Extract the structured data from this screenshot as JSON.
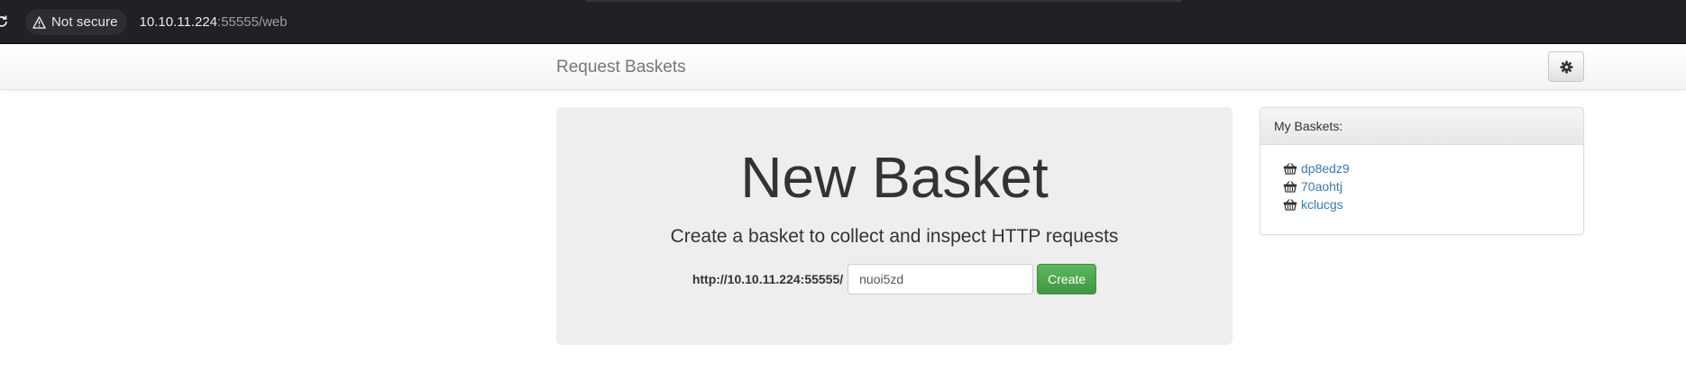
{
  "browser": {
    "security_label": "Not secure",
    "url_host": "10.10.11.224",
    "url_rest": ":55555/web"
  },
  "navbar": {
    "brand": "Request Baskets",
    "settings_icon": "gear-icon"
  },
  "jumbotron": {
    "title": "New Basket",
    "lead": "Create a basket to collect and inspect HTTP requests",
    "url_prefix": "http://10.10.11.224:55555/",
    "basket_name_value": "nuoi5zd",
    "create_label": "Create"
  },
  "my_baskets": {
    "heading": "My Baskets:",
    "items": [
      {
        "name": "dp8edz9",
        "icon": "basket-icon"
      },
      {
        "name": "70aohtj",
        "icon": "basket-icon"
      },
      {
        "name": "kclucgs",
        "icon": "basket-icon"
      }
    ]
  },
  "colors": {
    "chrome_bg": "#202124",
    "jumbotron_bg": "#eeeeee",
    "create_button": "#5cb85c",
    "link": "#337ab7"
  }
}
